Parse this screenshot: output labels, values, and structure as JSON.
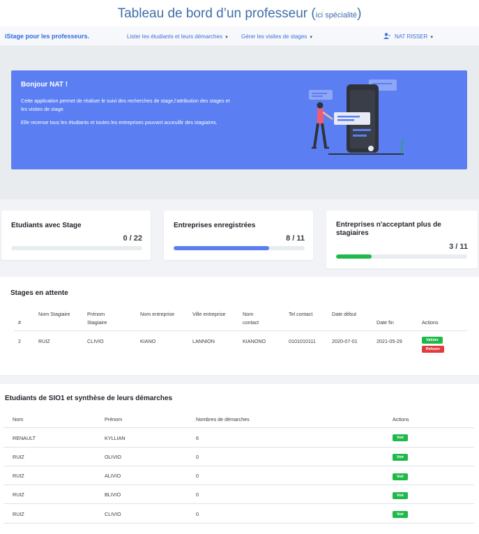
{
  "caption": {
    "main": "Tableau de bord d’un professeur (",
    "small": "ici spécialité",
    "close": ")"
  },
  "navbar": {
    "brand": "iStage pour les professeurs.",
    "menu1": "Lister les étudiants et leurs démarches",
    "menu2": "Gérer les visites de stages",
    "user": "NAT RISSER"
  },
  "hero": {
    "title": "Bonjour NAT !",
    "p1": "Cette application permet de réaliser le suivi des recherches de stage,l’attribution des stages et les visites de stage.",
    "p2": "Elle recense tous les étudiants et toutes les entreprises pouvant acceuillir des stagiaires."
  },
  "stats": [
    {
      "title": "Etudiants avec Stage",
      "value": "0 / 22",
      "fraction": 0.0,
      "color": "#e9ecef"
    },
    {
      "title": "Entreprises enregistrées",
      "value": "8 / 11",
      "fraction": 0.727,
      "color": "#5b7ff2"
    },
    {
      "title": "Entreprises n'acceptant plus de stagiaires",
      "value": "3 / 11",
      "fraction": 0.273,
      "color": "#1fb84a"
    }
  ],
  "pending": {
    "title": "Stages en attente",
    "headers": [
      "#",
      "Nom Stagiaire",
      "Prénom Stagiaire",
      "Nom entreprise",
      "Ville entreprise",
      "Nom contact",
      "Tel contact",
      "Date début",
      "Date fin",
      "Actions"
    ],
    "rows": [
      {
        "id": "2",
        "nom": "RUIZ",
        "prenom": "CLIVIO",
        "entreprise": "KIANO",
        "ville": "LANNION",
        "contact": "KIANONO",
        "tel": "0101010111",
        "debut": "2020-07-01",
        "fin": "2021-05-29",
        "validate": "Valider",
        "refuse": "Refuser"
      }
    ]
  },
  "students": {
    "title": "Etudiants de SIO1 et synthèse de leurs démarches",
    "headers": [
      "Nom",
      "Prénom",
      "Nombres de démarches",
      "Actions"
    ],
    "button": "Voir",
    "rows": [
      {
        "nom": "RENAULT",
        "prenom": "KYLLIAN",
        "count": "6"
      },
      {
        "nom": "RUIZ",
        "prenom": "OLIVIO",
        "count": "0"
      },
      {
        "nom": "RUIZ",
        "prenom": "ALIVIO",
        "count": "0"
      },
      {
        "nom": "RUIZ",
        "prenom": "BLIVIO",
        "count": "0"
      },
      {
        "nom": "RUIZ",
        "prenom": "CLIVIO",
        "count": "0"
      }
    ]
  }
}
